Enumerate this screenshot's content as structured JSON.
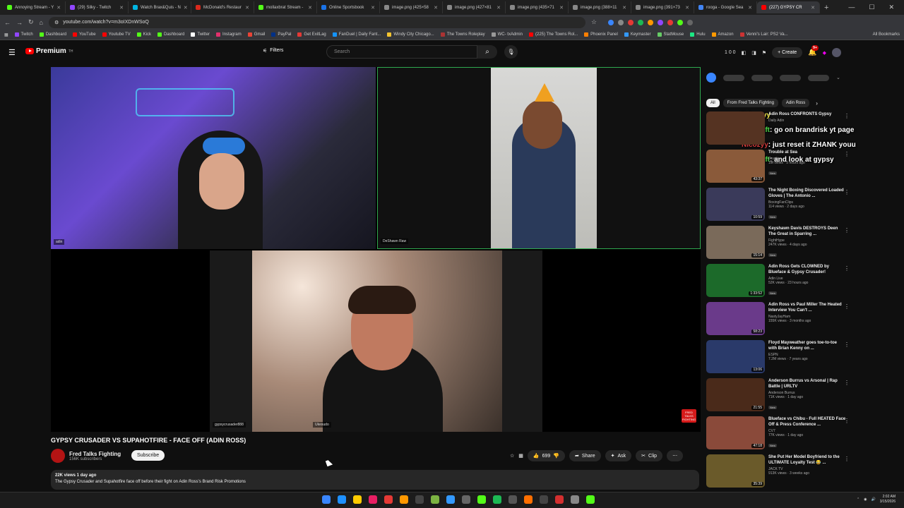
{
  "browser": {
    "tabs": [
      {
        "label": "Annoying Stream - Y",
        "color": "#53fc18"
      },
      {
        "label": "(29) Silky - Twitch",
        "color": "#9146ff"
      },
      {
        "label": "Watch Brax&Quis - N",
        "color": "#00b5e2"
      },
      {
        "label": "McDonald's Restaur",
        "color": "#da291c"
      },
      {
        "label": "mollaxbrat Stream -",
        "color": "#53fc18"
      },
      {
        "label": "Online Sportsbook",
        "color": "#1a73e8"
      },
      {
        "label": "image.png (425×58",
        "color": "#888888"
      },
      {
        "label": "image.png (427×81",
        "color": "#888888"
      },
      {
        "label": "image.png (435×71",
        "color": "#888888"
      },
      {
        "label": "image.png (388×11",
        "color": "#888888"
      },
      {
        "label": "image.png (391×73",
        "color": "#888888"
      },
      {
        "label": "rooga - Google Sea",
        "color": "#4285f4"
      },
      {
        "label": "(227) GYPSY CR",
        "color": "#ff0000"
      }
    ],
    "url": "youtube.com/watch?v=m3oIXDnWSoQ",
    "bookmarks": [
      {
        "label": "Twitch",
        "color": "#9146ff"
      },
      {
        "label": "Dashboard",
        "color": "#53fc18"
      },
      {
        "label": "YouTube",
        "color": "#ff0000"
      },
      {
        "label": "Youtube TV",
        "color": "#ff0000"
      },
      {
        "label": "Kick",
        "color": "#53fc18"
      },
      {
        "label": "Dashboard",
        "color": "#53fc18"
      },
      {
        "label": "Twitter",
        "color": "#ffffff"
      },
      {
        "label": "Instagram",
        "color": "#e1306c"
      },
      {
        "label": "Gmail",
        "color": "#ea4335"
      },
      {
        "label": "PayPal",
        "color": "#003087"
      },
      {
        "label": "Get ExitLag",
        "color": "#e53935"
      },
      {
        "label": "FanDuel | Daily Fant...",
        "color": "#1493ff"
      },
      {
        "label": "Windy City Chicago...",
        "color": "#f4c430"
      },
      {
        "label": "The Towns Roleplay",
        "color": "#aa3333"
      },
      {
        "label": "WC- txAdmin",
        "color": "#999999"
      },
      {
        "label": "(225) The Towns Rol...",
        "color": "#ff0000"
      },
      {
        "label": "Phoenix Panel",
        "color": "#ff7f00"
      },
      {
        "label": "Keymaster",
        "color": "#3399ff"
      },
      {
        "label": "StatMouse",
        "color": "#66cc66"
      },
      {
        "label": "Hulu",
        "color": "#1ce783"
      },
      {
        "label": "Amazon",
        "color": "#ff9900"
      },
      {
        "label": "Venni's Lair: PS2 Va...",
        "color": "#cc3333"
      }
    ],
    "all_bookmarks": "All Bookmarks"
  },
  "youtube": {
    "logo_text": "Premium",
    "logo_sup": "TH",
    "filters_label": "Filters",
    "search_placeholder": "Search",
    "header_stats": "1  0  0",
    "create_label": "Create",
    "notif_count": "9+"
  },
  "video": {
    "feed_labels": {
      "adin": "adin",
      "deshawn": "DeShawn Raw",
      "gypsy": "gypsycrusader888",
      "lower_mid": "Ukesudo"
    },
    "ftf_badge": "FRED TALKS FIGHTING",
    "title": "GYPSY CRUSADER VS SUPAHOTFIRE - FACE OFF (ADIN ROSS)",
    "channel_name": "Fred Talks Fighting",
    "channel_subs": "156K subscribers",
    "subscribe_label": "Subscribe",
    "like_count": "699",
    "share_label": "Share",
    "ask_label": "Ask",
    "clip_label": "Clip",
    "views_meta": "22K views  1 day ago",
    "description": "The Gypsy Crusader and Supahotfire face off before their fight on Adin Ross's Brand Risk Promotions"
  },
  "sidebar": {
    "chips": [
      "All",
      "From Fred Talks Fighting",
      "Adin Ross"
    ],
    "recs": [
      {
        "title": "Adin Ross CONFRONTS Gypsy",
        "channel": "Daily Adin",
        "views": "",
        "duration": "",
        "color": "#553322"
      },
      {
        "title": "Trouble at Sea",
        "channel": "Druski",
        "views": "1M views · 5 hours ago",
        "duration": "43:37",
        "color": "#8a5a3a",
        "is_new": true
      },
      {
        "title": "The Night Boxing Discovered Loaded Gloves | The Antonio ...",
        "channel": "BoxingFanClips",
        "views": "114 views · 2 days ago",
        "duration": "10:59",
        "color": "#3a3a5a",
        "is_new": true
      },
      {
        "title": "Keyshawn Davis DESTROYS Deen The Great in Sparring ...",
        "channel": "FightHype",
        "views": "247K views · 4 days ago",
        "duration": "15:14",
        "color": "#7a6a5a",
        "is_new": true
      },
      {
        "title": "Adin Ross Gets CLOWNED by Blueface & Gypsy Crusader!",
        "channel": "Adin Live",
        "views": "52K views · 23 hours ago",
        "duration": "1:33:52",
        "color": "#1c6a2a",
        "is_new": true
      },
      {
        "title": "Adin Ross vs Paul Miller The Heated Interview You Can't ...",
        "channel": "NastyJayHam",
        "views": "155K views · 3 months ago",
        "duration": "58:23",
        "color": "#6a3a8a"
      },
      {
        "title": "Floyd Mayweather goes toe-to-toe with Brian Kenny on ...",
        "channel": "ESPN",
        "views": "7.2M views · 7 years ago",
        "duration": "13:06",
        "color": "#2a3a6a"
      },
      {
        "title": "Anderson Burrus vs Arsonal | Rap Battle | URLTV",
        "channel": "Anderson Burrus",
        "views": "71K views · 1 day ago",
        "duration": "21:55",
        "color": "#4a2a1a",
        "is_new": true
      },
      {
        "title": "Blueface vs Chibu - Full HEATED Face Off & Press Conference ...",
        "channel": "CV7",
        "views": "77K views · 1 day ago",
        "duration": "47:18",
        "color": "#8a4a3a",
        "is_new": true
      },
      {
        "title": "She Put Her Model Boyfriend to the ULTIMATE Loyalty Test 😂 ...",
        "channel": "JACK TV",
        "views": "913K views · 3 weeks ago",
        "duration": "35:39",
        "color": "#6a5a2a"
      }
    ],
    "new_label": "New"
  },
  "chat_overlay": [
    {
      "user": "Tsleazyy",
      "msg": "",
      "user_class": "u1"
    },
    {
      "user": "Ahiksoft",
      "msg": ": go on brandrisk yt page",
      "user_class": "u2"
    },
    {
      "user": "Nicozyy",
      "msg": ": just reset it ZHANK youu",
      "user_class": "u3"
    },
    {
      "user": "Ahiksoft",
      "msg": ": and look at gypsy",
      "user_class": "u2"
    }
  ],
  "taskbar": {
    "time": "2:02 AM",
    "date": "3/15/2026",
    "icon_colors": [
      "#3a86ff",
      "#1e90ff",
      "#ffcc00",
      "#e91e63",
      "#e53935",
      "#ff9800",
      "#444444",
      "#7cb342",
      "#3399ff",
      "#666666",
      "#53fc18",
      "#1db954",
      "#555555",
      "#ff6f00",
      "#444444",
      "#d32f2f",
      "#888888",
      "#53fc18"
    ]
  }
}
